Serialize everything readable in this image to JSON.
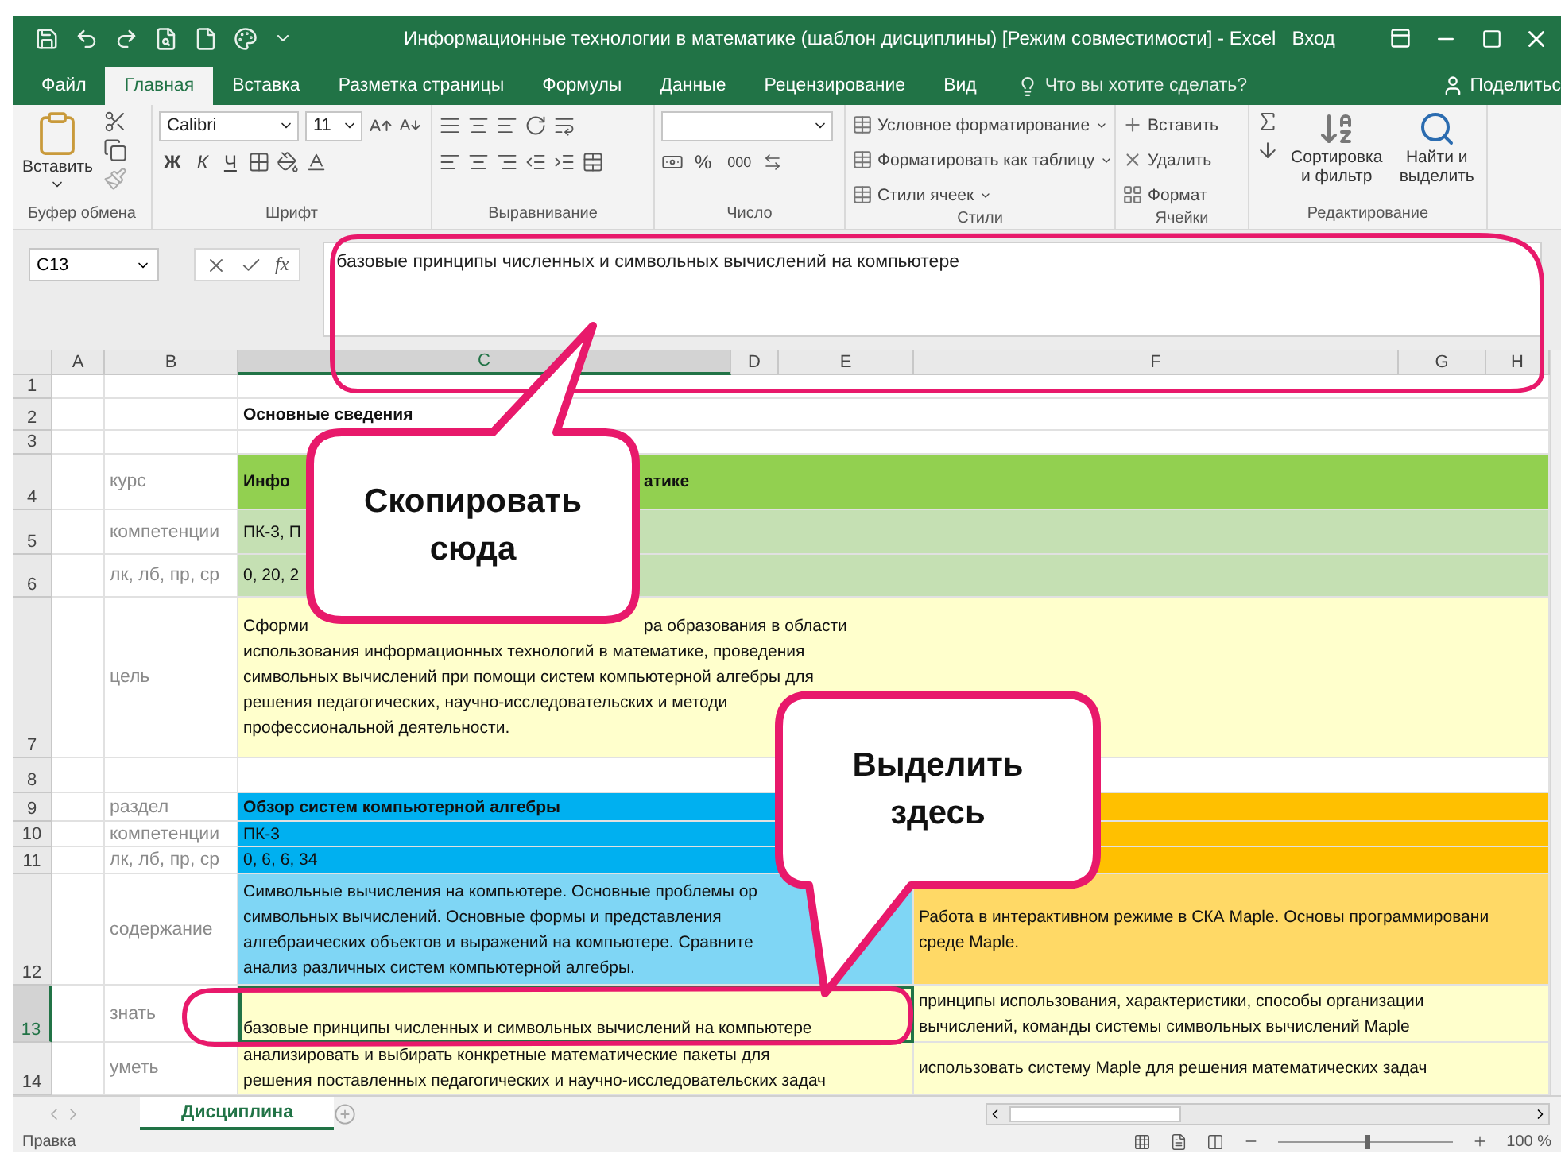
{
  "window": {
    "title": "Информационные технологии в математике (шаблон дисциплины)  [Режим совместимости]  -  Excel",
    "sign_in": "Вход"
  },
  "tabs": [
    {
      "label": "Файл",
      "selected": false
    },
    {
      "label": "Главная",
      "selected": true
    },
    {
      "label": "Вставка",
      "selected": false
    },
    {
      "label": "Разметка страницы",
      "selected": false
    },
    {
      "label": "Формулы",
      "selected": false
    },
    {
      "label": "Данные",
      "selected": false
    },
    {
      "label": "Рецензирование",
      "selected": false
    },
    {
      "label": "Вид",
      "selected": false
    }
  ],
  "tell_me": "Что вы хотите сделать?",
  "share": "Поделитьс",
  "ribbon": {
    "groups": [
      {
        "kind": "clipboard",
        "label": "Буфер обмена",
        "paste": "Вставить"
      },
      {
        "kind": "font",
        "label": "Шрифт",
        "font": "Calibri",
        "size": "11",
        "styles": [
          {
            "label": "Ж",
            "kind": "bold"
          },
          {
            "label": "К",
            "kind": "italic"
          },
          {
            "label": "Ч",
            "kind": "underline"
          }
        ]
      },
      {
        "kind": "alignment",
        "label": "Выравнивание"
      },
      {
        "kind": "number",
        "label": "Число",
        "percent": "%",
        "thousands": "000"
      },
      {
        "kind": "styles",
        "label": "Стили",
        "items": [
          "Условное форматирование",
          "Форматировать как таблицу",
          "Стили ячеек"
        ]
      },
      {
        "kind": "cells",
        "label": "Ячейки",
        "items": [
          "Вставить",
          "Удалить",
          "Формат"
        ]
      },
      {
        "kind": "editing",
        "label": "Редактирование",
        "items": [
          "Сортировка и фильтр",
          "Найти и выделить"
        ]
      }
    ]
  },
  "formula_bar": {
    "name_box": "C13",
    "function_label": "fx",
    "value": "базовые принципы численных и символьных вычислений на компьютере"
  },
  "columns": [
    {
      "label": "A",
      "selected": false
    },
    {
      "label": "B",
      "selected": false
    },
    {
      "label": "C",
      "selected": true
    },
    {
      "label": "D",
      "selected": false
    },
    {
      "label": "E",
      "selected": false
    },
    {
      "label": "F",
      "selected": false
    },
    {
      "label": "G",
      "selected": false
    },
    {
      "label": "H",
      "selected": false
    }
  ],
  "rows": [
    {
      "number": "1",
      "selected": false
    },
    {
      "number": "2",
      "selected": false,
      "kind": "heading",
      "main": {
        "lines": [
          [
            "Основные сведения"
          ]
        ]
      }
    },
    {
      "number": "3",
      "selected": false
    },
    {
      "number": "4",
      "selected": false,
      "kind": "heading",
      "label": "курс",
      "main": {
        "color": "#92d050",
        "lines": [
          [
            "Инфо",
            "атике"
          ]
        ]
      }
    },
    {
      "number": "5",
      "selected": false,
      "label": "компетенции",
      "main": {
        "color": "#c5e0b3",
        "lines": [
          [
            "ПК-3, П"
          ]
        ]
      }
    },
    {
      "number": "6",
      "selected": false,
      "label": "лк, лб, пр, ср",
      "main": {
        "color": "#c5e0b3",
        "lines": [
          [
            "0, 20, 2"
          ]
        ]
      }
    },
    {
      "number": "7",
      "selected": false,
      "label": "цель",
      "main": {
        "color": "#ffffcc",
        "lines": [
          [
            "Сформи",
            "ра образования в области"
          ],
          [
            "использования информационных технологий в математике, проведения"
          ],
          [
            "символьных вычислений при помощи систем компьютерной алгебры для"
          ],
          [
            "решения педагогических, научно-исследовательских и методи"
          ],
          [
            "профессиональной деятельности."
          ]
        ]
      }
    },
    {
      "number": "8",
      "selected": false
    },
    {
      "number": "9",
      "selected": false,
      "kind": "heading",
      "label": "раздел",
      "main": {
        "color": "#00b0f0",
        "lines": [
          [
            "Обзор систем компьютерной алгебры"
          ]
        ]
      },
      "side": {
        "color": "#ffc000"
      }
    },
    {
      "number": "10",
      "selected": false,
      "label": "компетенции",
      "main": {
        "color": "#00b0f0",
        "lines": [
          [
            "ПК-3"
          ]
        ]
      },
      "side": {
        "color": "#ffc000"
      }
    },
    {
      "number": "11",
      "selected": false,
      "label": "лк, лб, пр, ср",
      "main": {
        "color": "#00b0f0",
        "lines": [
          [
            "0, 6, 6, 34"
          ]
        ]
      },
      "side": {
        "color": "#ffc000"
      }
    },
    {
      "number": "12",
      "selected": false,
      "label": "содержание",
      "main": {
        "color": "#7fd6f5",
        "lines": [
          [
            "Символьные вычисления на компьютере. Основные проблемы ор"
          ],
          [
            "символьных вычислений. Основные формы и представления"
          ],
          [
            "алгебраических объектов и выражений на компьютере. Сравните"
          ],
          [
            "анализ различных систем компьютерной алгебры."
          ]
        ]
      },
      "side": {
        "color": "#ffd966",
        "lines": [
          [
            "Работа в интерактивном режиме в СКА Maple. Основы программировани"
          ],
          [
            "среде Maple."
          ]
        ]
      }
    },
    {
      "number": "13",
      "selected": true,
      "label": "знать",
      "main": {
        "color": "#ffffcc",
        "active": true,
        "lines": [
          [
            "базовые принципы численных и символьных вычислений на компьютере"
          ]
        ]
      },
      "side": {
        "color": "#ffffcc",
        "lines": [
          [
            "принципы использования, характеристики, способы организации"
          ],
          [
            "вычислений, команды системы символьных вычислений Maple"
          ]
        ]
      }
    },
    {
      "number": "14",
      "selected": false,
      "label": "уметь",
      "main": {
        "color": "#ffffcc",
        "lines": [
          [
            "анализировать и выбирать конкретные математические пакеты для"
          ],
          [
            "решения поставленных педагогических и научно-исследовательских задач"
          ]
        ]
      },
      "side": {
        "color": "#ffffcc",
        "lines": [
          [
            "использовать систему Maple для решения математических задач"
          ]
        ]
      }
    }
  ],
  "sheets": [
    {
      "label": "Дисциплина",
      "selected": true
    }
  ],
  "status": {
    "mode": "Правка",
    "zoom": {
      "level": 0.5,
      "label": "100 %"
    }
  },
  "callouts": [
    {
      "text": "Скопировать сюда"
    },
    {
      "text": "Выделить здесь"
    }
  ]
}
